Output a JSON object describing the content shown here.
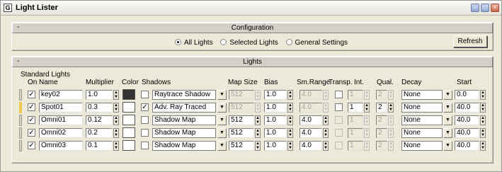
{
  "window": {
    "title": "Light Lister",
    "icon_name": "app-logo-icon",
    "controls": [
      "minimize-icon",
      "maximize-icon",
      "close-icon"
    ]
  },
  "configuration": {
    "toggle": "-",
    "title": "Configuration",
    "options": [
      {
        "label": "All Lights",
        "selected": true
      },
      {
        "label": "Selected Lights",
        "selected": false
      },
      {
        "label": "General Settings",
        "selected": false
      }
    ],
    "refresh_label": "Refresh"
  },
  "lights": {
    "toggle": "-",
    "title": "Lights",
    "group_label": "Standard Lights",
    "headers": {
      "on": "On",
      "name": "Name",
      "multiplier": "Multiplier",
      "color": "Color",
      "shadows": "Shadows",
      "map_size": "Map Size",
      "bias": "Bias",
      "sm_range": "Sm.Range",
      "transp": "Transp.",
      "int": "Int.",
      "qual": "Qual.",
      "decay": "Decay",
      "start": "Start"
    },
    "rows": [
      {
        "on": true,
        "name": "key02",
        "multiplier": "1.0",
        "color": "#333333",
        "shadow_on": false,
        "shadow_type": "Raytrace Shadow",
        "map_size": "512",
        "map_size_enabled": false,
        "bias": "1.0",
        "sm_range": "4.0",
        "sm_range_enabled": false,
        "transp": false,
        "transp_enabled": true,
        "int": "1",
        "int_enabled": false,
        "qual": "2",
        "qual_enabled": false,
        "decay": "None",
        "start": "0.0",
        "selected": false
      },
      {
        "on": true,
        "name": "Spot01",
        "multiplier": "0.3",
        "color": "#ffffff",
        "shadow_on": true,
        "shadow_type": "Adv. Ray Traced",
        "map_size": "512",
        "map_size_enabled": false,
        "bias": "1.0",
        "sm_range": "4.0",
        "sm_range_enabled": false,
        "transp": false,
        "transp_enabled": true,
        "int": "1",
        "int_enabled": true,
        "qual": "2",
        "qual_enabled": true,
        "decay": "None",
        "start": "40.0",
        "selected": true
      },
      {
        "on": true,
        "name": "Omni01",
        "multiplier": "0.12",
        "color": "#ffffff",
        "shadow_on": false,
        "shadow_type": "Shadow Map",
        "map_size": "512",
        "map_size_enabled": true,
        "bias": "1.0",
        "sm_range": "4.0",
        "sm_range_enabled": true,
        "transp": false,
        "transp_enabled": false,
        "int": "1",
        "int_enabled": false,
        "qual": "2",
        "qual_enabled": false,
        "decay": "None",
        "start": "40.0",
        "selected": false
      },
      {
        "on": true,
        "name": "Omni02",
        "multiplier": "0.2",
        "color": "#ffffff",
        "shadow_on": false,
        "shadow_type": "Shadow Map",
        "map_size": "512",
        "map_size_enabled": true,
        "bias": "1.0",
        "sm_range": "4.0",
        "sm_range_enabled": true,
        "transp": false,
        "transp_enabled": false,
        "int": "1",
        "int_enabled": false,
        "qual": "2",
        "qual_enabled": false,
        "decay": "None",
        "start": "40.0",
        "selected": false
      },
      {
        "on": true,
        "name": "Omni03",
        "multiplier": "0.1",
        "color": "#ffffff",
        "shadow_on": false,
        "shadow_type": "Shadow Map",
        "map_size": "512",
        "map_size_enabled": true,
        "bias": "1.0",
        "sm_range": "4.0",
        "sm_range_enabled": true,
        "transp": false,
        "transp_enabled": false,
        "int": "1",
        "int_enabled": false,
        "qual": "2",
        "qual_enabled": false,
        "decay": "None",
        "start": "40.0",
        "selected": false
      }
    ]
  }
}
